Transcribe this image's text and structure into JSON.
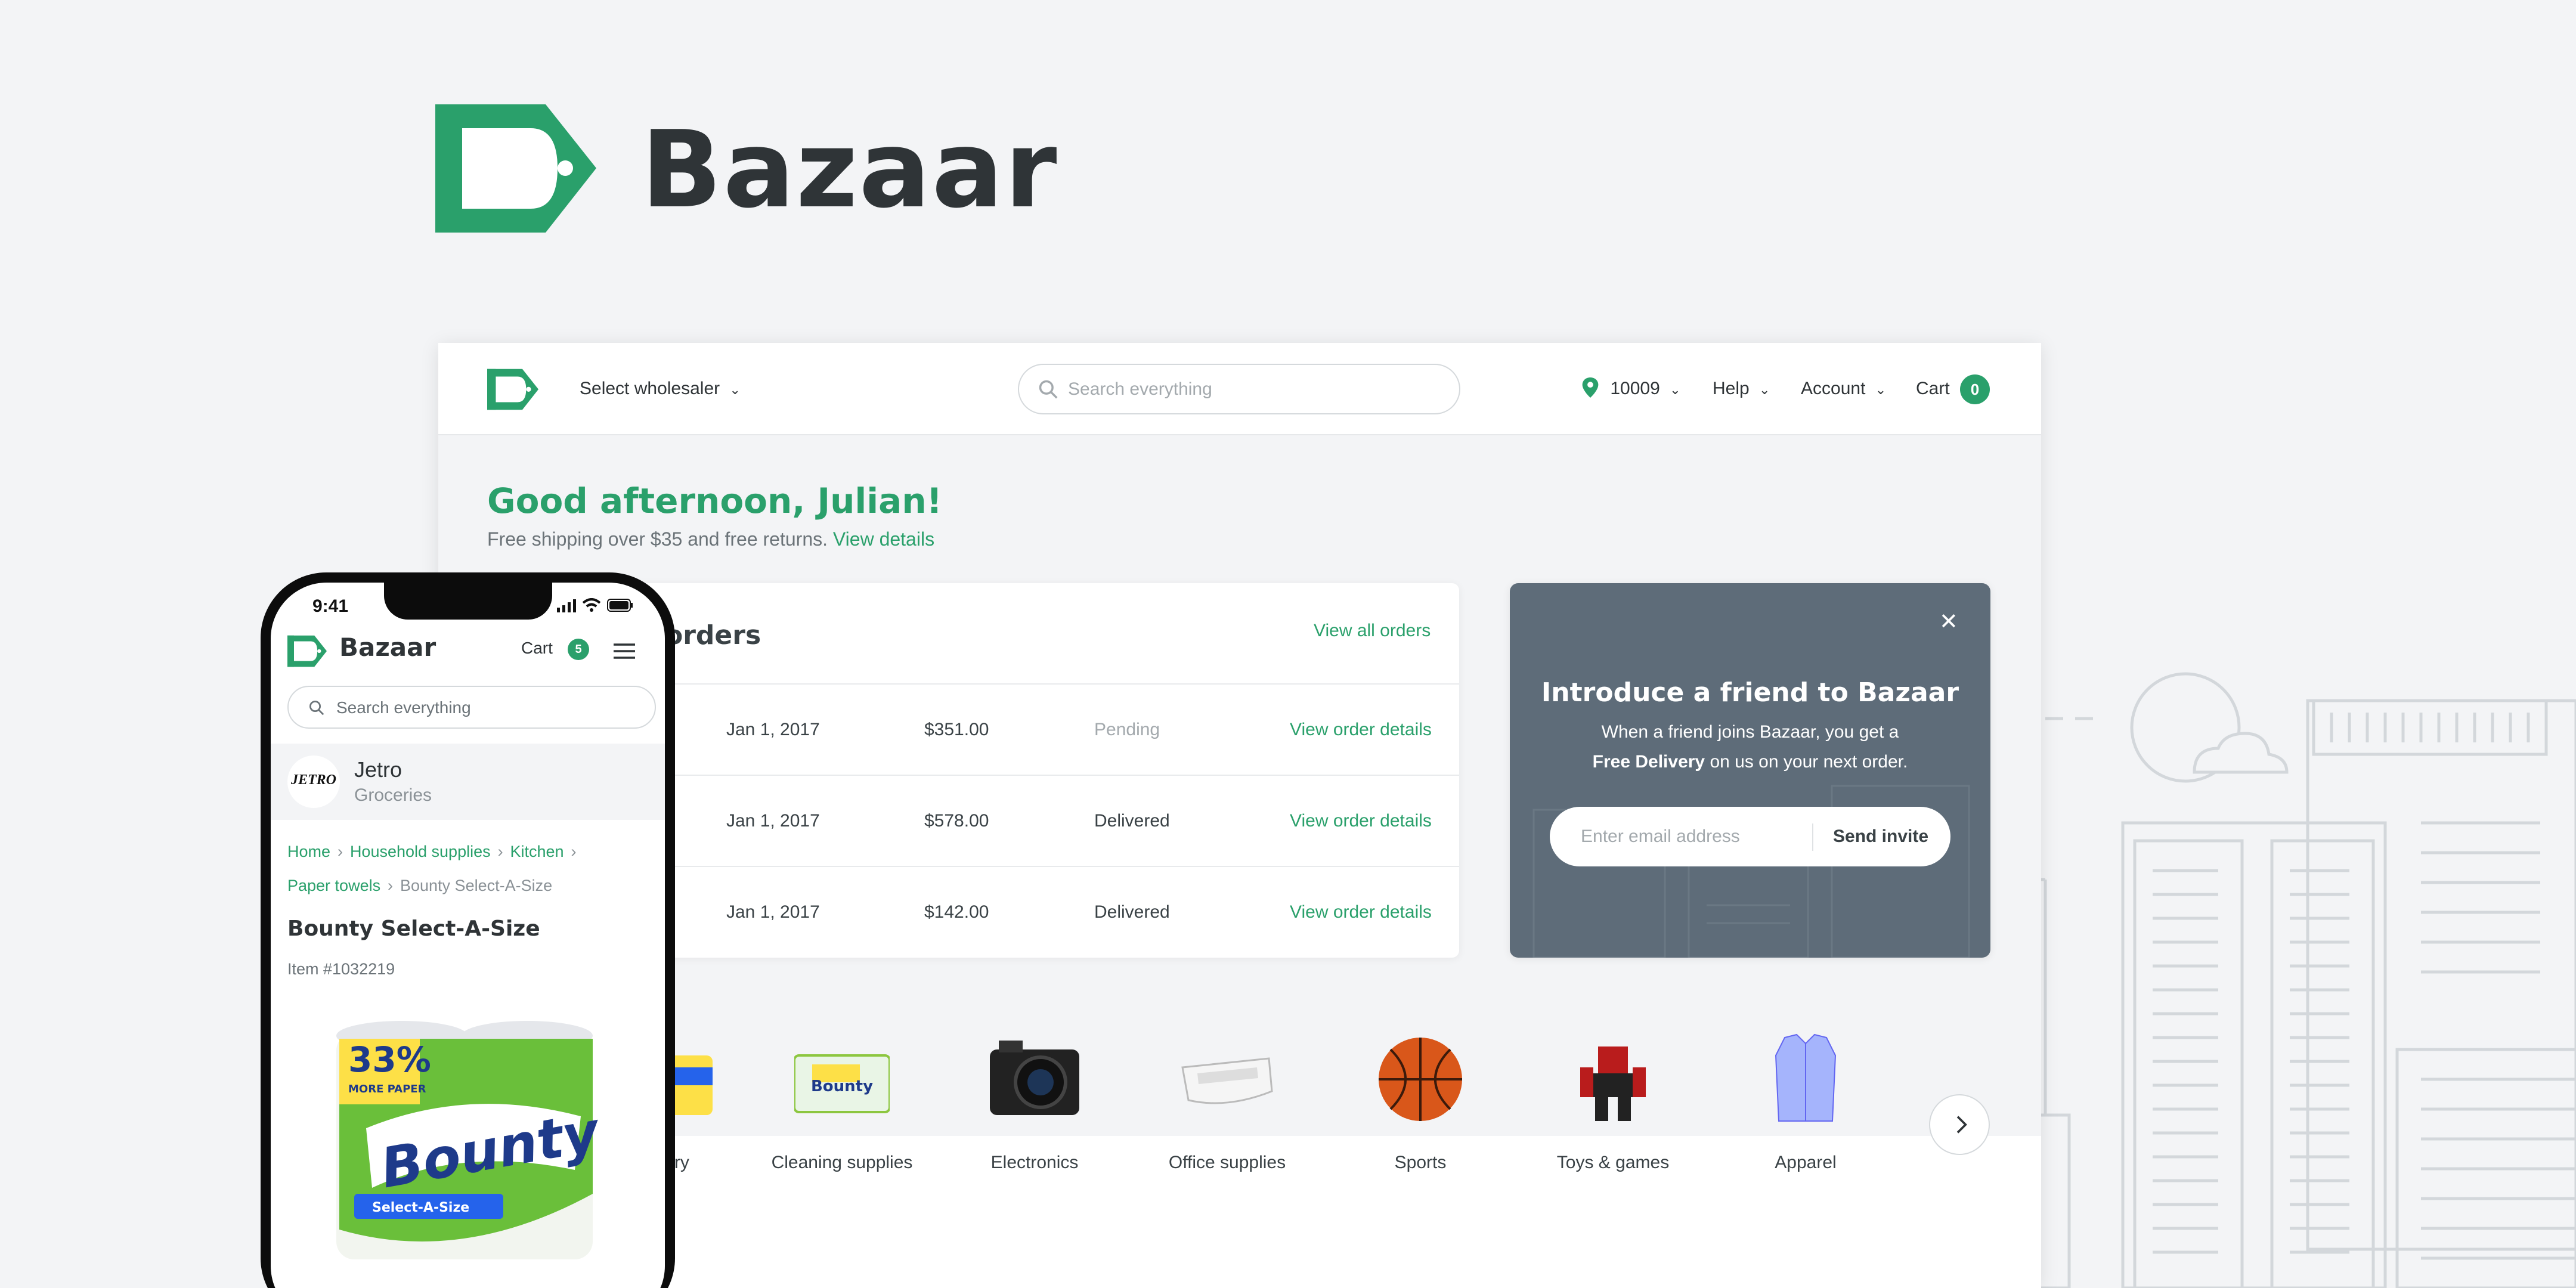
{
  "brand": {
    "name": "Bazaar",
    "color": "#2aa06b"
  },
  "desktop": {
    "nav": {
      "wholesaler": "Select wholesaler",
      "search_placeholder": "Search everything",
      "location": "10009",
      "help": "Help",
      "account": "Account",
      "cart": "Cart",
      "cart_count": "0"
    },
    "greeting": "Good afternoon, Julian!",
    "subtext": "Free shipping over $35 and free returns.",
    "subtext_link": "View details",
    "orders": {
      "title": "orders",
      "view_all": "View all orders",
      "rows": [
        {
          "date": "Jan 1, 2017",
          "amount": "$351.00",
          "status": "Pending",
          "link": "View order details"
        },
        {
          "date": "Jan 1, 2017",
          "amount": "$578.00",
          "status": "Delivered",
          "link": "View order details"
        },
        {
          "date": "Jan 1, 2017",
          "amount": "$142.00",
          "status": "Delivered",
          "link": "View order details"
        }
      ]
    },
    "referral": {
      "title": "Introduce a friend to Bazaar",
      "body_line1": "When a friend joins Bazaar, you get a",
      "body_bold": "Free Delivery",
      "body_line2": "on us on your next order.",
      "placeholder": "Enter email address",
      "button": "Send invite"
    },
    "categories": [
      "ory",
      "Cleaning supplies",
      "Electronics",
      "Office supplies",
      "Sports",
      "Toys & games",
      "Apparel"
    ]
  },
  "phone": {
    "time": "9:41",
    "brand": "Bazaar",
    "cart": "Cart",
    "cart_count": "5",
    "search_placeholder": "Search everything",
    "store": {
      "logo_text": "JETRO",
      "name": "Jetro",
      "category": "Groceries"
    },
    "breadcrumb": [
      "Home",
      "Household supplies",
      "Kitchen",
      "Paper towels",
      "Bounty Select-A-Size"
    ],
    "product_title": "Bounty Select-A-Size",
    "item_number": "Item #1032219",
    "product_pack": {
      "badge": "33%",
      "badge_sub": "MORE PAPER",
      "brand": "Bounty",
      "variant": "Select-A-Size"
    }
  }
}
